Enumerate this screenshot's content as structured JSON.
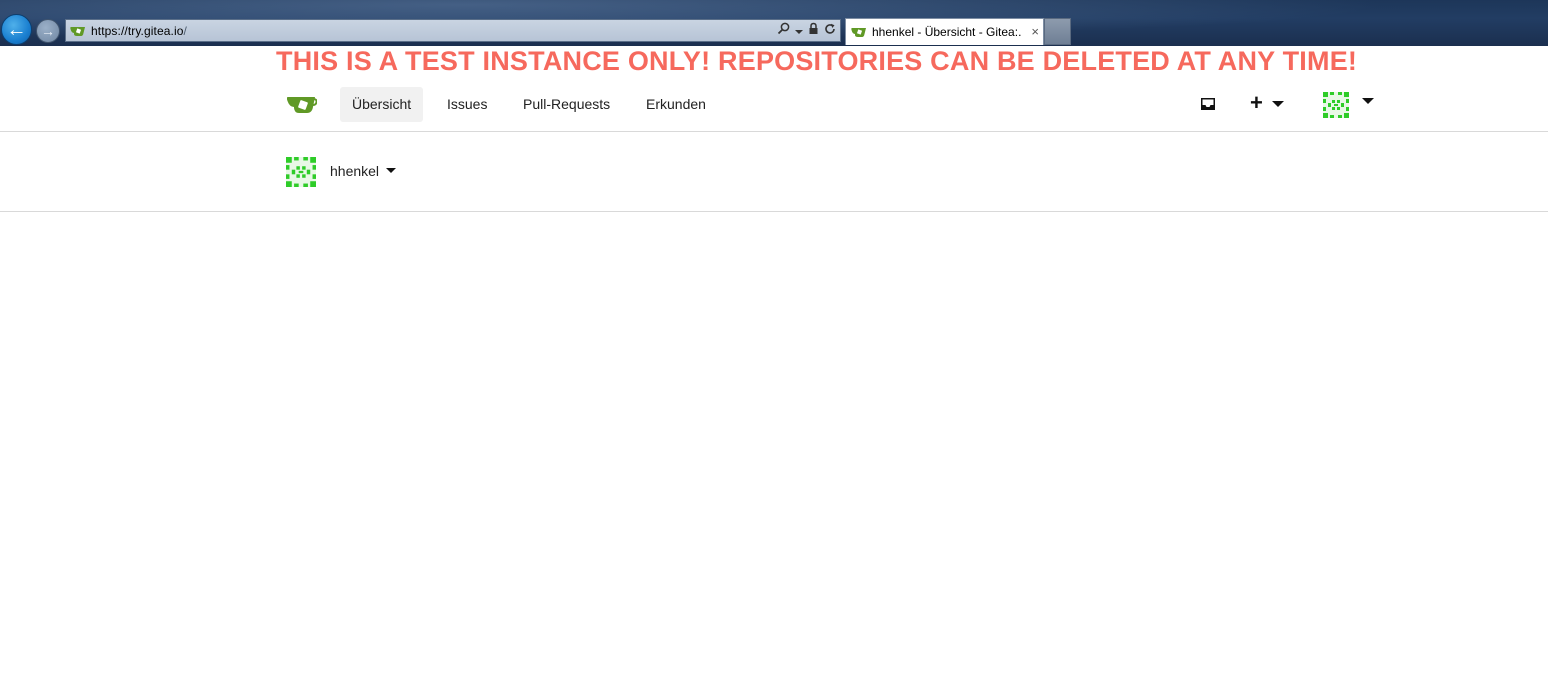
{
  "browser": {
    "url_host": "https://try.gitea.io",
    "url_path": "/",
    "tab_title": "hhenkel - Übersicht - Gitea:...",
    "tab_close_glyph": "×",
    "back_glyph": "←",
    "forward_glyph": "→",
    "address_icons": [
      "search-icon",
      "dropdown-icon",
      "lock-icon",
      "refresh-icon"
    ]
  },
  "banner": {
    "text": "THIS IS A TEST INSTANCE ONLY! REPOSITORIES CAN BE DELETED AT ANY TIME!",
    "color": "#f6695d"
  },
  "nav": {
    "items": [
      {
        "label": "Übersicht",
        "active": true
      },
      {
        "label": "Issues",
        "active": false
      },
      {
        "label": "Pull-Requests",
        "active": false
      },
      {
        "label": "Erkunden",
        "active": false
      }
    ],
    "plus_label": "+",
    "right_icons": [
      "inbox-icon",
      "plus-icon",
      "user-avatar-icon"
    ]
  },
  "context": {
    "username": "hhenkel"
  },
  "colors": {
    "brand_green": "#609926",
    "avatar_green": "#2ecc28"
  }
}
